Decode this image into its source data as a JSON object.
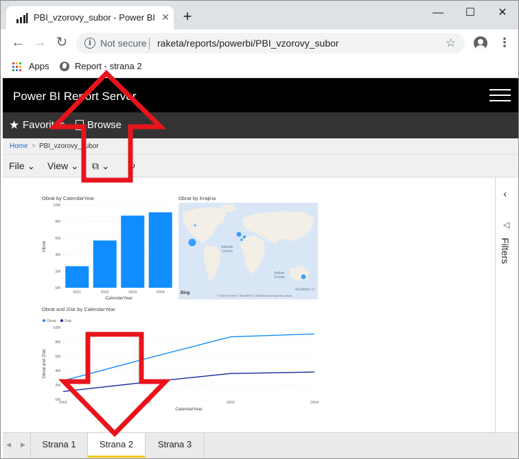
{
  "browser": {
    "tab_title": "PBI_vzorovy_subor - Power BI Report Server",
    "close_glyph": "✕",
    "new_tab_glyph": "+",
    "minimize_glyph": "—",
    "maximize_glyph": "☐",
    "window_close_glyph": "✕",
    "back_glyph": "←",
    "forward_glyph": "→",
    "reload_glyph": "↻",
    "security_label": "Not secure",
    "url": "raketa/reports/powerbi/PBI_vzorovy_subor",
    "menu_glyph": "⋮",
    "bookmarks": [
      {
        "label": "Apps",
        "icon": "apps-grid-icon"
      },
      {
        "label": "Report - strana 2",
        "icon": "globe-icon"
      }
    ]
  },
  "pbi": {
    "app_title": "Power BI Report Server",
    "nav": {
      "favorites": "Favorites",
      "browse": "Browse"
    },
    "breadcrumb": {
      "home": "Home",
      "separator": ">",
      "current": "PBI_vzorovy_subor"
    },
    "actions": {
      "file": "File",
      "view": "View"
    },
    "filters_label": "Filters",
    "page_tabs": [
      {
        "label": "Strana 1",
        "active": false
      },
      {
        "label": "Strana 2",
        "active": true
      },
      {
        "label": "Strana 3",
        "active": false
      }
    ]
  },
  "visuals": {
    "bar_title": "Obrat by CalendarYear",
    "map_title": "Obrat by Krajina",
    "map_labels": {
      "atlantic": "Atlantic Ocean",
      "indian": "Indian Ocean",
      "southern": "Southern O",
      "bing": "Bing",
      "copyright": "© 2020 TomTom® © 2020 HERE, © 2020 Microsoft Corporation Terms"
    },
    "line_title": "Obrat and Zisk by CalendarYear"
  },
  "chart_data": [
    {
      "type": "bar",
      "title": "Obrat by CalendarYear",
      "xlabel": "CalendarYear",
      "ylabel": "Obrat",
      "categories": [
        "2001",
        "2002",
        "2003",
        "2004"
      ],
      "values": [
        2.6,
        5.7,
        8.7,
        9.1
      ],
      "yticks": [
        "0M",
        "2M",
        "4M",
        "6M",
        "8M",
        "10M"
      ],
      "ylim": [
        0,
        10
      ],
      "color": "#118dff"
    },
    {
      "type": "line",
      "title": "Obrat and Zisk by CalendarYear",
      "xlabel": "CalendarYear",
      "ylabel": "Obrat and Zisk",
      "categories": [
        "2001",
        "2002",
        "2003",
        "2004"
      ],
      "series": [
        {
          "name": "Obrat",
          "values": [
            2.6,
            5.7,
            8.7,
            9.1
          ],
          "color": "#118dff"
        },
        {
          "name": "Zisk",
          "values": [
            1.1,
            2.4,
            3.6,
            3.8
          ],
          "color": "#12239e"
        }
      ],
      "yticks": [
        "0M",
        "2M",
        "4M",
        "6M",
        "8M",
        "10M"
      ],
      "ylim": [
        0,
        10
      ],
      "legend": "top-left"
    }
  ]
}
